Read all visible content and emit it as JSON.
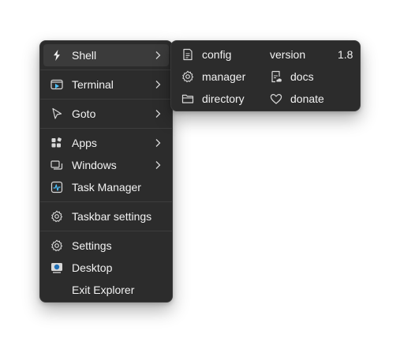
{
  "main_menu": {
    "items": [
      {
        "label": "Shell",
        "icon": "shell-bolt-icon",
        "has_submenu": true
      },
      {
        "label": "Terminal",
        "icon": "terminal-icon",
        "has_submenu": true
      },
      {
        "label": "Goto",
        "icon": "cursor-arrow-icon",
        "has_submenu": true
      },
      {
        "label": "Apps",
        "icon": "apps-grid-icon",
        "has_submenu": true
      },
      {
        "label": "Windows",
        "icon": "windows-stack-icon",
        "has_submenu": true
      },
      {
        "label": "Task Manager",
        "icon": "task-manager-icon",
        "has_submenu": false
      },
      {
        "label": "Taskbar settings",
        "icon": "gear-icon",
        "has_submenu": false
      },
      {
        "label": "Settings",
        "icon": "gear-icon",
        "has_submenu": false
      },
      {
        "label": "Desktop",
        "icon": "desktop-icon",
        "has_submenu": false
      },
      {
        "label": "Exit Explorer",
        "icon": "",
        "has_submenu": false
      }
    ]
  },
  "shell_submenu": {
    "config": "config",
    "version": "version",
    "version_number": "1.8",
    "manager": "manager",
    "docs": "docs",
    "directory": "directory",
    "donate": "donate"
  },
  "colors": {
    "menu_bg": "#2c2c2c",
    "hover_bg": "#3b3b3b",
    "text": "#f2f2f2",
    "accent_blue": "#4cc2ff"
  }
}
